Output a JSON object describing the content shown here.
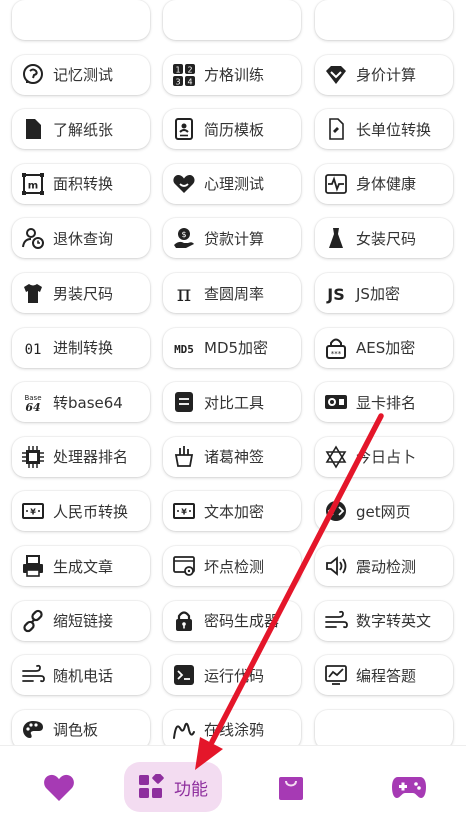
{
  "features": [
    {
      "id": "partial-1",
      "label": "",
      "icon": "partial-icon"
    },
    {
      "id": "partial-2",
      "label": "",
      "icon": "partial-icon"
    },
    {
      "id": "partial-3",
      "label": "",
      "icon": "partial-icon"
    },
    {
      "id": "memory-test",
      "label": "记忆测试",
      "icon": "head-icon"
    },
    {
      "id": "grid-training",
      "label": "方格训练",
      "icon": "number-grid-icon"
    },
    {
      "id": "value-calc",
      "label": "身价计算",
      "icon": "diamond-icon"
    },
    {
      "id": "paper-size",
      "label": "了解纸张",
      "icon": "file-icon"
    },
    {
      "id": "resume-template",
      "label": "简历模板",
      "icon": "resume-icon"
    },
    {
      "id": "length-convert",
      "label": "长单位转换",
      "icon": "ruler-doc-icon"
    },
    {
      "id": "area-convert",
      "label": "面积转换",
      "icon": "area-icon"
    },
    {
      "id": "psych-test",
      "label": "心理测试",
      "icon": "heart-smile-icon"
    },
    {
      "id": "body-health",
      "label": "身体健康",
      "icon": "pulse-icon"
    },
    {
      "id": "retire-query",
      "label": "退休查询",
      "icon": "person-clock-icon"
    },
    {
      "id": "loan-calc",
      "label": "贷款计算",
      "icon": "hand-money-icon"
    },
    {
      "id": "women-size",
      "label": "女装尺码",
      "icon": "dress-icon"
    },
    {
      "id": "men-size",
      "label": "男装尺码",
      "icon": "tshirt-icon"
    },
    {
      "id": "pi-lookup",
      "label": "查圆周率",
      "icon": "pi-icon"
    },
    {
      "id": "js-encrypt",
      "label": "JS加密",
      "icon": "js-icon"
    },
    {
      "id": "base-convert",
      "label": "进制转换",
      "icon": "binary-icon"
    },
    {
      "id": "md5-encrypt",
      "label": "MD5加密",
      "icon": "md5-icon"
    },
    {
      "id": "aes-encrypt",
      "label": "AES加密",
      "icon": "lock-text-icon"
    },
    {
      "id": "base64",
      "label": "转base64",
      "icon": "base64-icon"
    },
    {
      "id": "compare-tool",
      "label": "对比工具",
      "icon": "compare-icon"
    },
    {
      "id": "gpu-rank",
      "label": "显卡排名",
      "icon": "gpu-icon"
    },
    {
      "id": "cpu-rank",
      "label": "处理器排名",
      "icon": "cpu-icon"
    },
    {
      "id": "zhuge-lots",
      "label": "诸葛神签",
      "icon": "fortune-icon"
    },
    {
      "id": "today-divination",
      "label": "今日占卜",
      "icon": "star-of-david-icon"
    },
    {
      "id": "rmb-convert",
      "label": "人民币转换",
      "icon": "banknote-icon"
    },
    {
      "id": "text-encrypt",
      "label": "文本加密",
      "icon": "banknote-icon"
    },
    {
      "id": "get-webpage",
      "label": "get网页",
      "icon": "code-circle-icon"
    },
    {
      "id": "gen-article",
      "label": "生成文章",
      "icon": "printer-icon"
    },
    {
      "id": "dead-pixel",
      "label": "坏点检测",
      "icon": "screen-gear-icon"
    },
    {
      "id": "vibration-test",
      "label": "震动检测",
      "icon": "speaker-icon"
    },
    {
      "id": "short-link",
      "label": "缩短链接",
      "icon": "link-icon"
    },
    {
      "id": "password-gen",
      "label": "密码生成器",
      "icon": "lock-icon"
    },
    {
      "id": "num-to-english",
      "label": "数字转英文",
      "icon": "wind-icon"
    },
    {
      "id": "random-phone",
      "label": "随机电话",
      "icon": "wind-icon"
    },
    {
      "id": "run-code",
      "label": "运行代码",
      "icon": "terminal-icon"
    },
    {
      "id": "code-quiz",
      "label": "编程答题",
      "icon": "chart-monitor-icon"
    },
    {
      "id": "palette",
      "label": "调色板",
      "icon": "palette-icon"
    },
    {
      "id": "online-doodle",
      "label": "在线涂鸦",
      "icon": "scribble-icon"
    },
    {
      "id": "hidden-slot",
      "label": "",
      "icon": "partial-icon"
    }
  ],
  "tabs": [
    {
      "id": "favorites",
      "label": "",
      "icon": "heart-icon"
    },
    {
      "id": "features",
      "label": "功能",
      "icon": "apps-icon",
      "active": true
    },
    {
      "id": "shop",
      "label": "",
      "icon": "bag-icon"
    },
    {
      "id": "games",
      "label": "",
      "icon": "gamepad-icon"
    }
  ],
  "colors": {
    "accent": "#8e2f9e",
    "tab_icon": "#a63ab4",
    "tab_active_bg": "#f3dcf1",
    "text": "#333333",
    "icon": "#222222",
    "arrow": "#e4162a"
  }
}
